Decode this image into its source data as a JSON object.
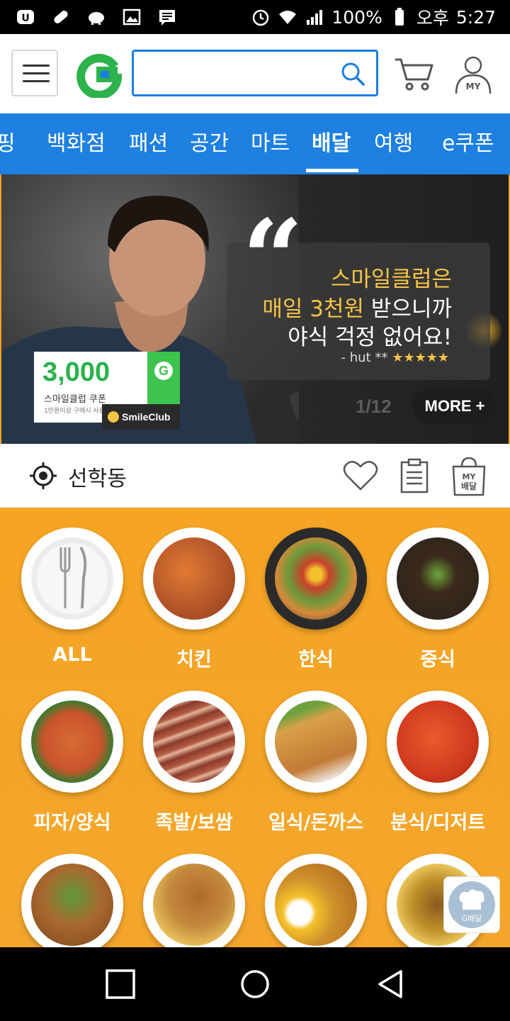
{
  "status_bar": {
    "battery": "100%",
    "ampm": "오후",
    "time": "5:27"
  },
  "header": {
    "logo": "G",
    "search": {
      "value": "",
      "placeholder": ""
    }
  },
  "tabs": [
    {
      "label": "핑",
      "active": false
    },
    {
      "label": "백화점",
      "active": false
    },
    {
      "label": "패션",
      "active": false
    },
    {
      "label": "공간",
      "active": false
    },
    {
      "label": "마트",
      "active": false
    },
    {
      "label": "배달",
      "active": true
    },
    {
      "label": "여행",
      "active": false
    },
    {
      "label": "e쿠폰",
      "active": false
    }
  ],
  "banner": {
    "quote_line1": "스마일클럽은",
    "quote_line2_highlight": "매일 3천원",
    "quote_line2_rest": " 받으니까",
    "quote_line3": "야식 걱정 없어요!",
    "author": "- hut **",
    "stars": "★★★★★",
    "coupon_amount": "3,000",
    "coupon_title": "스마일클럽 쿠폰",
    "coupon_sub": "1만원이상 구매시 사용",
    "coupon_g": "G",
    "smileclub": "SmileClub",
    "pager": "1/12",
    "more_label": "MORE +"
  },
  "location": {
    "name": "선학동",
    "my_baedal_line1": "MY",
    "my_baedal_line2": "배달"
  },
  "categories": [
    {
      "label": "ALL",
      "color": "#e9e9e9"
    },
    {
      "label": "치킨",
      "color": "#b5562a"
    },
    {
      "label": "한식",
      "color": "#2a2a2a"
    },
    {
      "label": "중식",
      "color": "#2b2118"
    },
    {
      "label": "피자/양식",
      "color": "#c9542c"
    },
    {
      "label": "족발/보쌈",
      "color": "#8a3b2a"
    },
    {
      "label": "일식/돈까스",
      "color": "#c27a34"
    },
    {
      "label": "분식/디저트",
      "color": "#d13a1e"
    },
    {
      "label": "",
      "color": "#a9692f"
    },
    {
      "label": "",
      "color": "#c48a3d"
    },
    {
      "label": "",
      "color": "#d0912c"
    },
    {
      "label": "",
      "color": "#c0922a"
    }
  ],
  "float_badge": {
    "label": "G배달"
  }
}
